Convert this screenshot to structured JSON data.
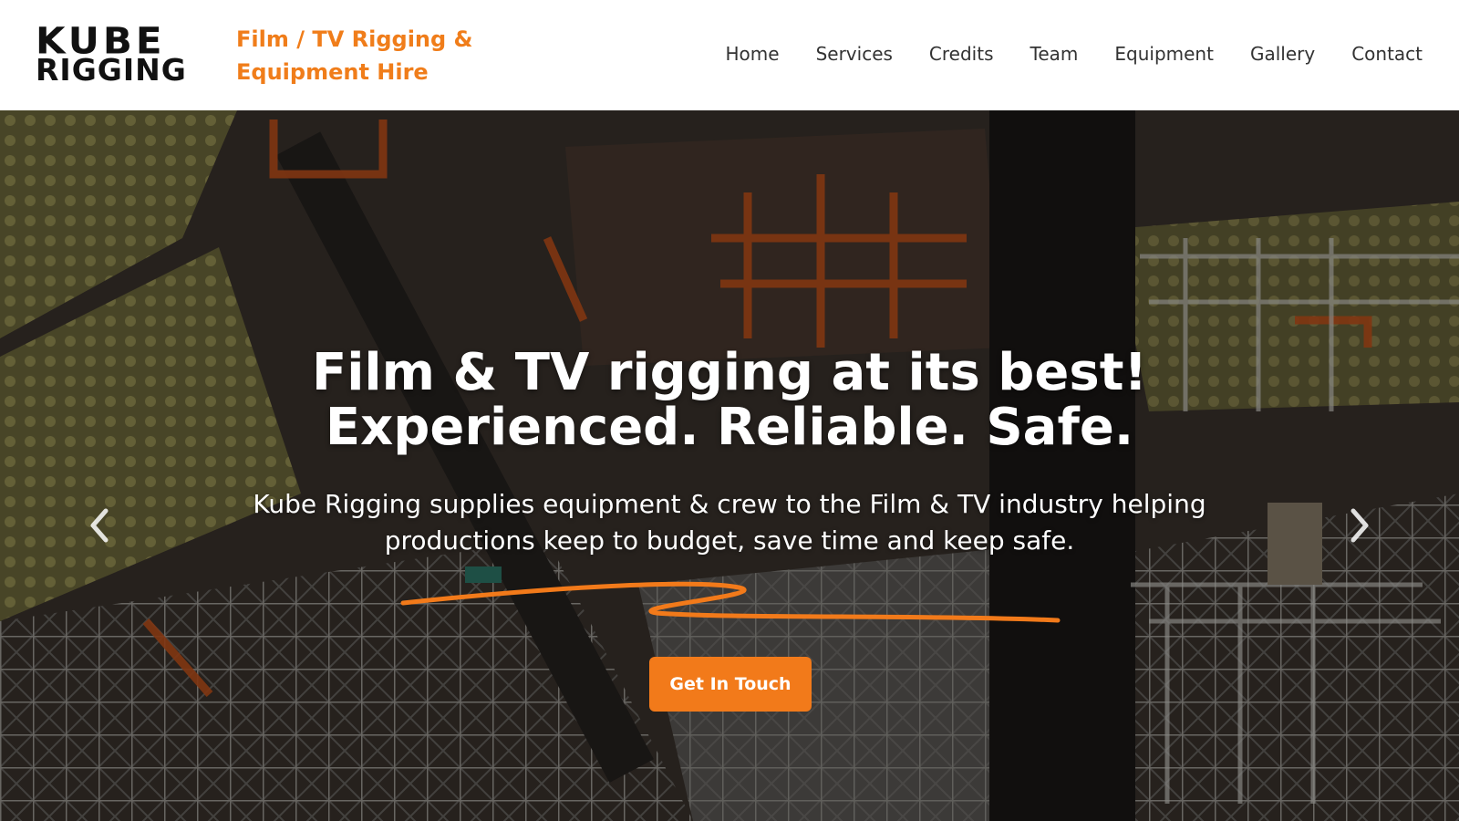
{
  "header": {
    "logo": {
      "line1": "KUBE",
      "line2": "RIGGING"
    },
    "tagline": "Film / TV Rigging & Equipment Hire",
    "nav": [
      {
        "label": "Home"
      },
      {
        "label": "Services"
      },
      {
        "label": "Credits"
      },
      {
        "label": "Team"
      },
      {
        "label": "Equipment"
      },
      {
        "label": "Gallery"
      },
      {
        "label": "Contact"
      }
    ]
  },
  "hero": {
    "title_line1": "Film & TV rigging at its best!",
    "title_line2": "Experienced. Reliable. Safe.",
    "subtitle": "Kube Rigging supplies equipment & crew to the Film & TV industry helping productions keep to budget, save time and keep safe.",
    "cta_label": "Get In Touch",
    "prev_icon": "chevron-left-icon",
    "next_icon": "chevron-right-icon"
  },
  "colors": {
    "accent": "#f27a1a",
    "nav_text": "#333333",
    "logo_text": "#111111"
  }
}
